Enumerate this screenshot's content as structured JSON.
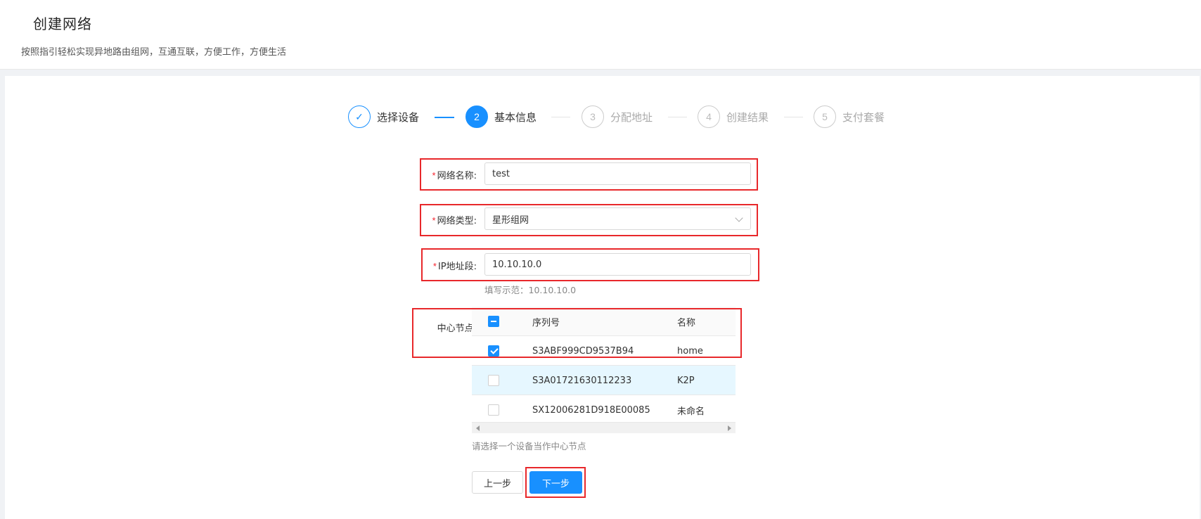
{
  "header": {
    "title": "创建网络",
    "subtitle": "按照指引轻松实现异地路由组网，互通互联，方便工作，方便生活"
  },
  "steps": [
    {
      "index": "✓",
      "label": "选择设备",
      "state": "done"
    },
    {
      "index": "2",
      "label": "基本信息",
      "state": "active"
    },
    {
      "index": "3",
      "label": "分配地址",
      "state": "pending"
    },
    {
      "index": "4",
      "label": "创建结果",
      "state": "pending"
    },
    {
      "index": "5",
      "label": "支付套餐",
      "state": "pending"
    }
  ],
  "form": {
    "required_mark": "*",
    "network_name": {
      "label": "网络名称:",
      "value": "test"
    },
    "network_type": {
      "label": "网络类型:",
      "value": "星形组网"
    },
    "ip_segment": {
      "label": "IP地址段:",
      "value": "10.10.10.0",
      "hint": "填写示范：10.10.10.0"
    },
    "center_node": {
      "label": "中心节点:",
      "hint": "请选择一个设备当作中心节点",
      "columns": [
        "序列号",
        "名称"
      ],
      "rows": [
        {
          "serial": "S3ABF999CD9537B94",
          "name": "home",
          "checked": true
        },
        {
          "serial": "S3A01721630112233",
          "name": "K2P",
          "checked": false
        },
        {
          "serial": "SX12006281D918E00085",
          "name": "未命名",
          "checked": false
        }
      ]
    }
  },
  "buttons": {
    "prev": "上一步",
    "next": "下一步"
  },
  "colors": {
    "primary": "#1890ff",
    "highlight_box": "#e8282b",
    "required": "#f5222d"
  }
}
